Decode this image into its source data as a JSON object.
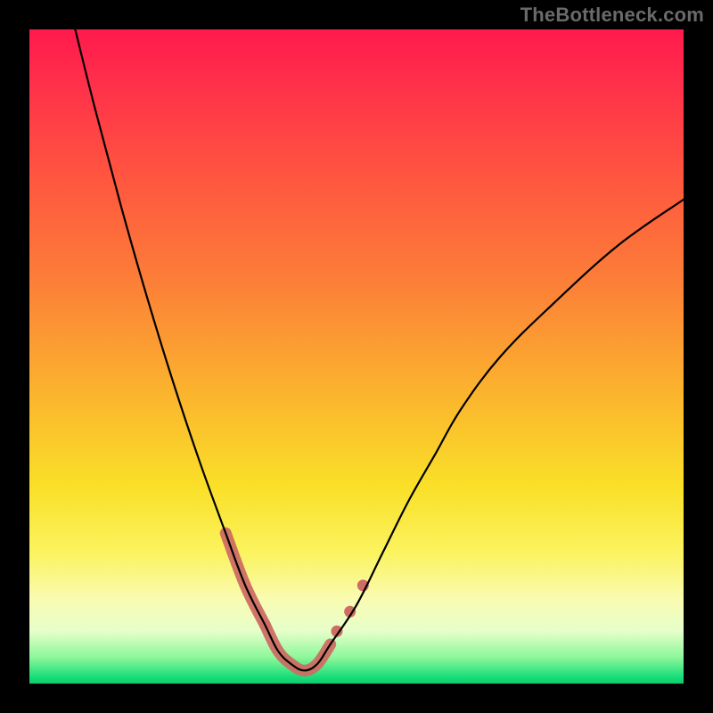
{
  "watermark": "TheBottleneck.com",
  "chart_data": {
    "type": "line",
    "title": "",
    "xlabel": "",
    "ylabel": "",
    "xlim": [
      0,
      100
    ],
    "ylim": [
      0,
      100
    ],
    "grid": false,
    "legend": false,
    "series": [
      {
        "name": "bottleneck-curve",
        "x": [
          7,
          10,
          14,
          18,
          22,
          26,
          30,
          33,
          36,
          38,
          40,
          42,
          44,
          46,
          50,
          54,
          58,
          62,
          66,
          72,
          80,
          90,
          100
        ],
        "y": [
          100,
          88,
          73,
          59,
          46,
          34,
          23,
          15,
          9,
          5,
          3,
          2,
          3,
          6,
          12,
          20,
          28,
          35,
          42,
          50,
          58,
          67,
          74
        ],
        "stroke": "#000000"
      },
      {
        "name": "highlight-left",
        "x": [
          30,
          33,
          36
        ],
        "y": [
          23,
          15,
          9
        ],
        "stroke": "#ce6d63"
      },
      {
        "name": "highlight-bottom",
        "x": [
          36,
          38,
          40,
          42,
          44,
          46
        ],
        "y": [
          9,
          5,
          3,
          2,
          3,
          6
        ],
        "stroke": "#ce6d63"
      },
      {
        "name": "highlight-right-dots",
        "x": [
          47,
          49,
          51
        ],
        "y": [
          8,
          11,
          15
        ],
        "stroke": "#ce6d63"
      }
    ],
    "background_gradient": {
      "direction": "vertical",
      "stops": [
        {
          "pos": 0.0,
          "color": "#ff1a4d"
        },
        {
          "pos": 0.22,
          "color": "#ff5440"
        },
        {
          "pos": 0.55,
          "color": "#fbb22e"
        },
        {
          "pos": 0.8,
          "color": "#fbf35f"
        },
        {
          "pos": 0.92,
          "color": "#e6ffcb"
        },
        {
          "pos": 1.0,
          "color": "#0fc96b"
        }
      ]
    }
  }
}
